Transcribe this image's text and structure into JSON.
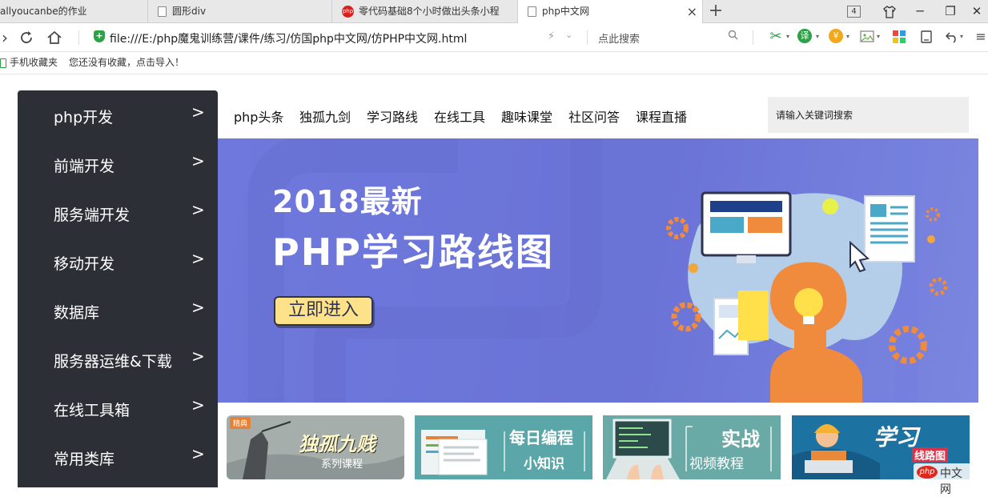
{
  "browser": {
    "tabs": [
      {
        "label": "allyoucanbe的作业",
        "icon": "page-icon",
        "active": false
      },
      {
        "label": "圆形div",
        "icon": "page-icon",
        "active": false
      },
      {
        "label": "零代码基础8个小时做出头条小程",
        "icon": "php-logo-icon",
        "active": false
      },
      {
        "label": "php中文网",
        "icon": "page-icon",
        "active": true
      }
    ],
    "tab_close": "×",
    "new_tab": "+",
    "tab_count": "4",
    "window_buttons": {
      "minimize": "─",
      "restore": "❐",
      "close": "✕"
    },
    "address": {
      "url": "file:///E:/php魔鬼训练营/课件/练习/仿国php中文网/仿PHP中文网.html",
      "search_hint": "点此搜索"
    },
    "bookmarks": {
      "folder_label": "手机收藏夹",
      "import_hint": "您还没有收藏，点击导入！"
    }
  },
  "page": {
    "sidebar": {
      "items": [
        {
          "label": "php开发",
          "arrow": ">"
        },
        {
          "label": "前端开发",
          "arrow": ">"
        },
        {
          "label": "服务端开发",
          "arrow": ">"
        },
        {
          "label": "移动开发",
          "arrow": ">"
        },
        {
          "label": "数据库",
          "arrow": ">"
        },
        {
          "label": "服务器运维&下载",
          "arrow": ">"
        },
        {
          "label": "在线工具箱",
          "arrow": ">"
        },
        {
          "label": "常用类库",
          "arrow": ">"
        }
      ]
    },
    "nav": {
      "items": [
        "php头条",
        "独孤九剑",
        "学习路线",
        "在线工具",
        "趣味课堂",
        "社区问答",
        "课程直播"
      ]
    },
    "search": {
      "placeholder": "请输入关键词搜索"
    },
    "banner": {
      "year_line": "2018最新",
      "title": "PHP学习路线图",
      "cta": "立即进入",
      "colors": {
        "background": "#6f78dc",
        "cta": "#fde28a",
        "orange": "#f08a3c"
      }
    },
    "cards": [
      {
        "tag": "精典",
        "title": "独孤九贱",
        "subtitle": "系列课程",
        "bg": "#9aa5a5"
      },
      {
        "title": "每日编程",
        "subtitle": "小知识",
        "bg": "#5fa6a6"
      },
      {
        "title": "实战",
        "subtitle": "视频教程",
        "bg": "#6aa8a6"
      },
      {
        "title": "学习",
        "subtitle": "线路图",
        "bg": "#1e78a0"
      }
    ],
    "watermark": {
      "logo": "php",
      "text": "中文网"
    }
  }
}
